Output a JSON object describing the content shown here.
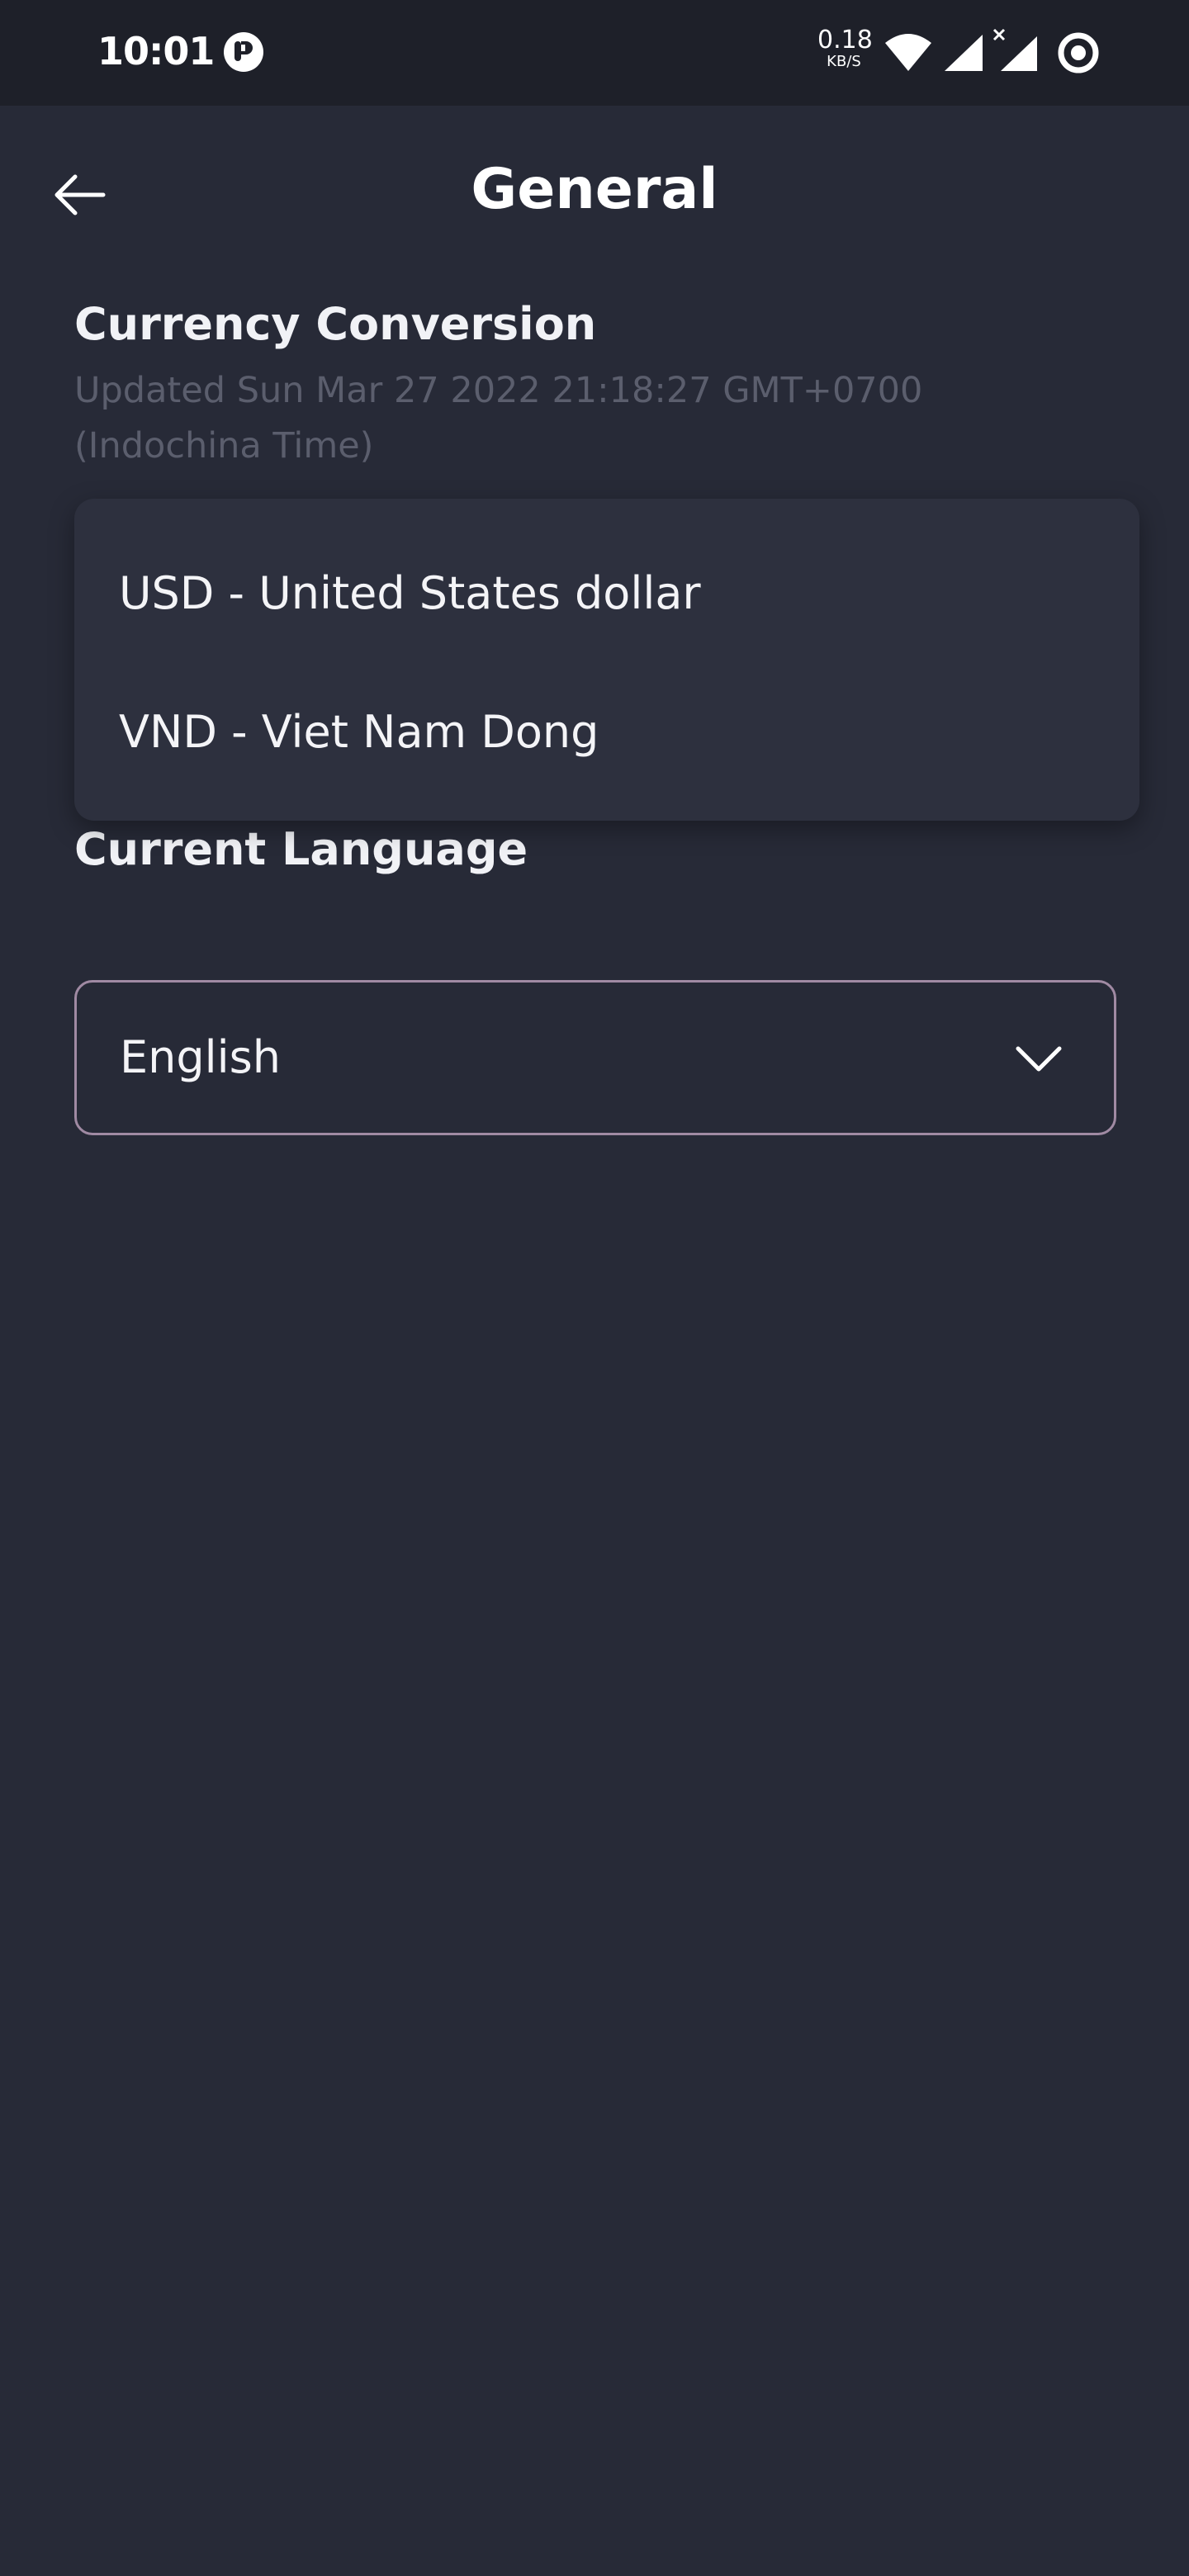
{
  "status_bar": {
    "time": "10:01",
    "net_speed_value": "0.18",
    "net_speed_unit": "KB/S",
    "icons": [
      "notification-app-icon",
      "wifi-icon",
      "signal-icon",
      "signal-no-data-icon",
      "ring-icon"
    ]
  },
  "header": {
    "title": "General",
    "back_icon": "arrow-left-icon"
  },
  "currency": {
    "title": "Currency Conversion",
    "updated_line1": "Updated Sun Mar 27 2022 21:18:27 GMT+0700",
    "updated_line2": "(Indochina Time)",
    "options": [
      {
        "label": "USD - United States dollar"
      },
      {
        "label": "VND - Viet Nam Dong"
      }
    ]
  },
  "language": {
    "title": "Current Language",
    "selected": "English",
    "chevron_icon": "chevron-down-icon"
  },
  "colors": {
    "background": "#272a37",
    "status_bar": "#1e2029",
    "menu": "#2d303e",
    "muted_text": "#5b5e6d",
    "select_border": "#a08aa3"
  }
}
